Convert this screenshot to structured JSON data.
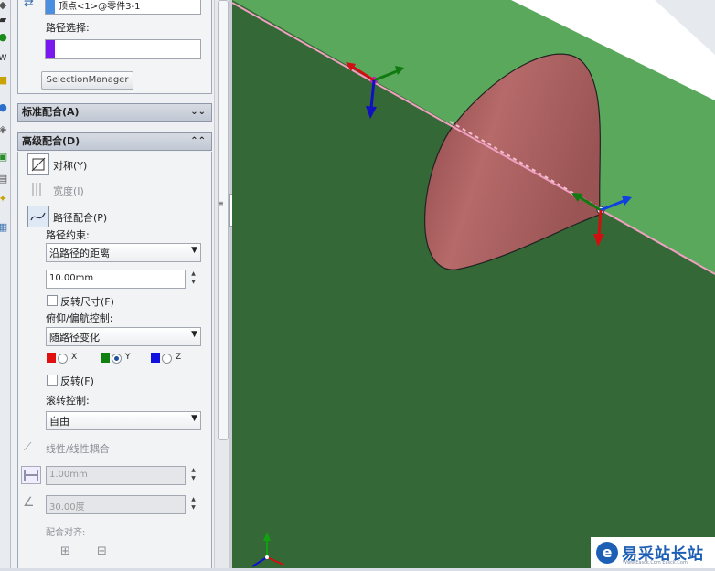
{
  "panel": {
    "top_field_value": "顶点<1>@零件3-1",
    "path_selection_label": "路径选择:",
    "selection_manager_button": "SelectionManager",
    "standard_mates_header": "标准配合(A)",
    "advanced_mates_header": "高级配合(D)",
    "mates": [
      {
        "label": "对称(Y)",
        "enabled": true
      },
      {
        "label": "宽度(I)",
        "enabled": false
      },
      {
        "label": "路径配合(P)",
        "enabled": true
      }
    ],
    "path_constraint_label": "路径约束:",
    "path_constraint_value": "沿路径的距离",
    "distance_value": "10.00mm",
    "flip_dimension_label": "反转尺寸(F)",
    "pitch_yaw_label": "俯仰/偏航控制:",
    "pitch_yaw_value": "随路径变化",
    "axes": [
      {
        "label": "X",
        "color": "#e01010",
        "selected": false
      },
      {
        "label": "Y",
        "color": "#108010",
        "selected": true
      },
      {
        "label": "Z",
        "color": "#1010e0",
        "selected": false
      }
    ],
    "flip_label": "反转(F)",
    "roll_control_label": "滚转控制:",
    "roll_control_value": "自由",
    "linear_coupler_label": "线性/线性耦合",
    "linear_value": "1.00mm",
    "angle_value": "30.00度",
    "mate_alignment_label": "配合对齐:"
  },
  "colors": {
    "plane_dark": "#356837",
    "plane_light": "#5aa85c",
    "cone": "#a85a5a",
    "path_line": "#f0a0c0",
    "path_swatch": "#7a18f0",
    "top_swatch": "#4a8fe0"
  },
  "watermark": {
    "title": "易采站长站",
    "subtitle": "Www.Easck.Com  Easck.Com"
  }
}
